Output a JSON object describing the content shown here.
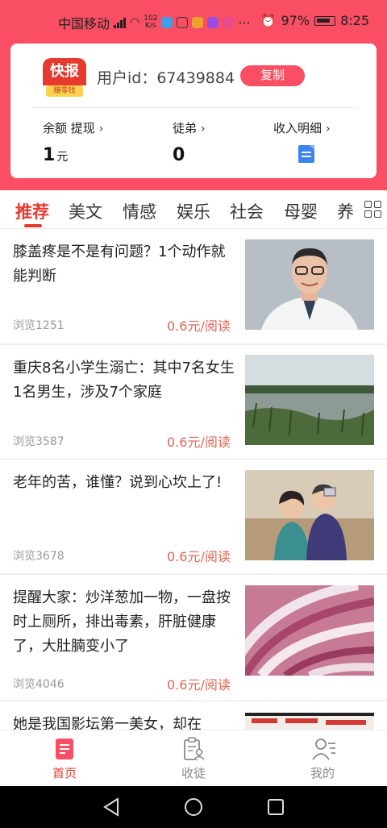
{
  "status_bar": {
    "carrier": "中国移动",
    "net_speed_value": "102",
    "net_speed_unit": "K/s",
    "battery": "97%",
    "time": "8:25"
  },
  "profile": {
    "logo_text": "快报",
    "logo_sub": "赚零钱",
    "user_id_label": "用户id：67439884",
    "copy_label": "复制",
    "balance_label": "余额 提现",
    "balance_value": "1",
    "balance_unit": "元",
    "apprentice_label": "徒弟",
    "apprentice_value": "0",
    "income_label": "收入明细"
  },
  "tabs": [
    "推荐",
    "美文",
    "情感",
    "娱乐",
    "社会",
    "母婴",
    "养"
  ],
  "articles": [
    {
      "title": "膝盖疼是不是有问题？1个动作就能判断",
      "views": "浏览1251",
      "price": "0.6元/阅读"
    },
    {
      "title": "重庆8名小学生溺亡：其中7名女生1名男生，涉及7个家庭",
      "views": "浏览3587",
      "price": "0.6元/阅读"
    },
    {
      "title": "老年的苦，谁懂？说到心坎上了!",
      "views": "浏览3678",
      "price": "0.6元/阅读"
    },
    {
      "title": "提醒大家：炒洋葱加一物，一盘按时上厕所，排出毒素，肝脏健康了，大肚腩变小了",
      "views": "浏览4046",
      "price": "0.6元/阅读"
    },
    {
      "title": "她是我国影坛第一美女，却在"
    }
  ],
  "bottom_nav": [
    {
      "label": "首页"
    },
    {
      "label": "收徒"
    },
    {
      "label": "我的"
    }
  ],
  "colors": {
    "accent": "#f94e63",
    "price": "#e06655",
    "active": "#e63a2e"
  }
}
